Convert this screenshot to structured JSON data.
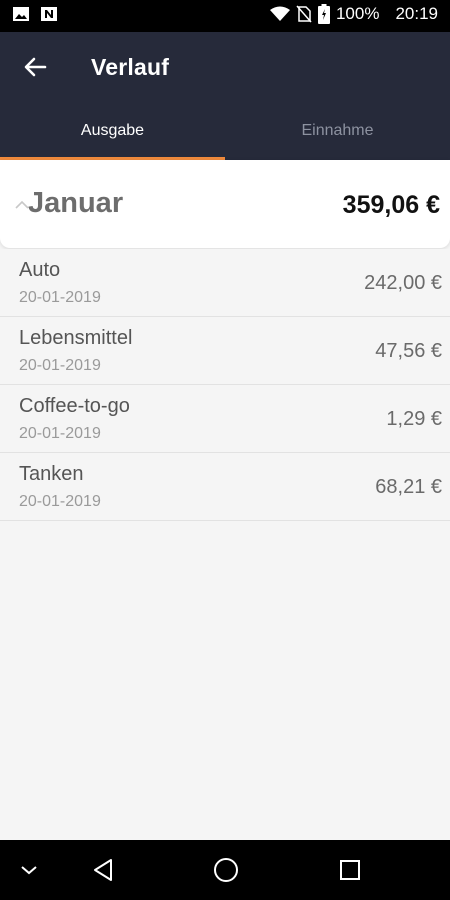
{
  "status": {
    "battery": "100%",
    "time": "20:19"
  },
  "header": {
    "title": "Verlauf"
  },
  "tabs": [
    {
      "label": "Ausgabe"
    },
    {
      "label": "Einnahme"
    }
  ],
  "month": {
    "name": "Januar",
    "total": "359,06 €"
  },
  "entries": [
    {
      "name": "Auto",
      "date": "20-01-2019",
      "amount": "242,00 €"
    },
    {
      "name": "Lebensmittel",
      "date": "20-01-2019",
      "amount": "47,56 €"
    },
    {
      "name": "Coffee-to-go",
      "date": "20-01-2019",
      "amount": "1,29 €"
    },
    {
      "name": "Tanken",
      "date": "20-01-2019",
      "amount": "68,21 €"
    }
  ],
  "colors": {
    "header": "#262a3a",
    "accent": "#f08a3c"
  }
}
